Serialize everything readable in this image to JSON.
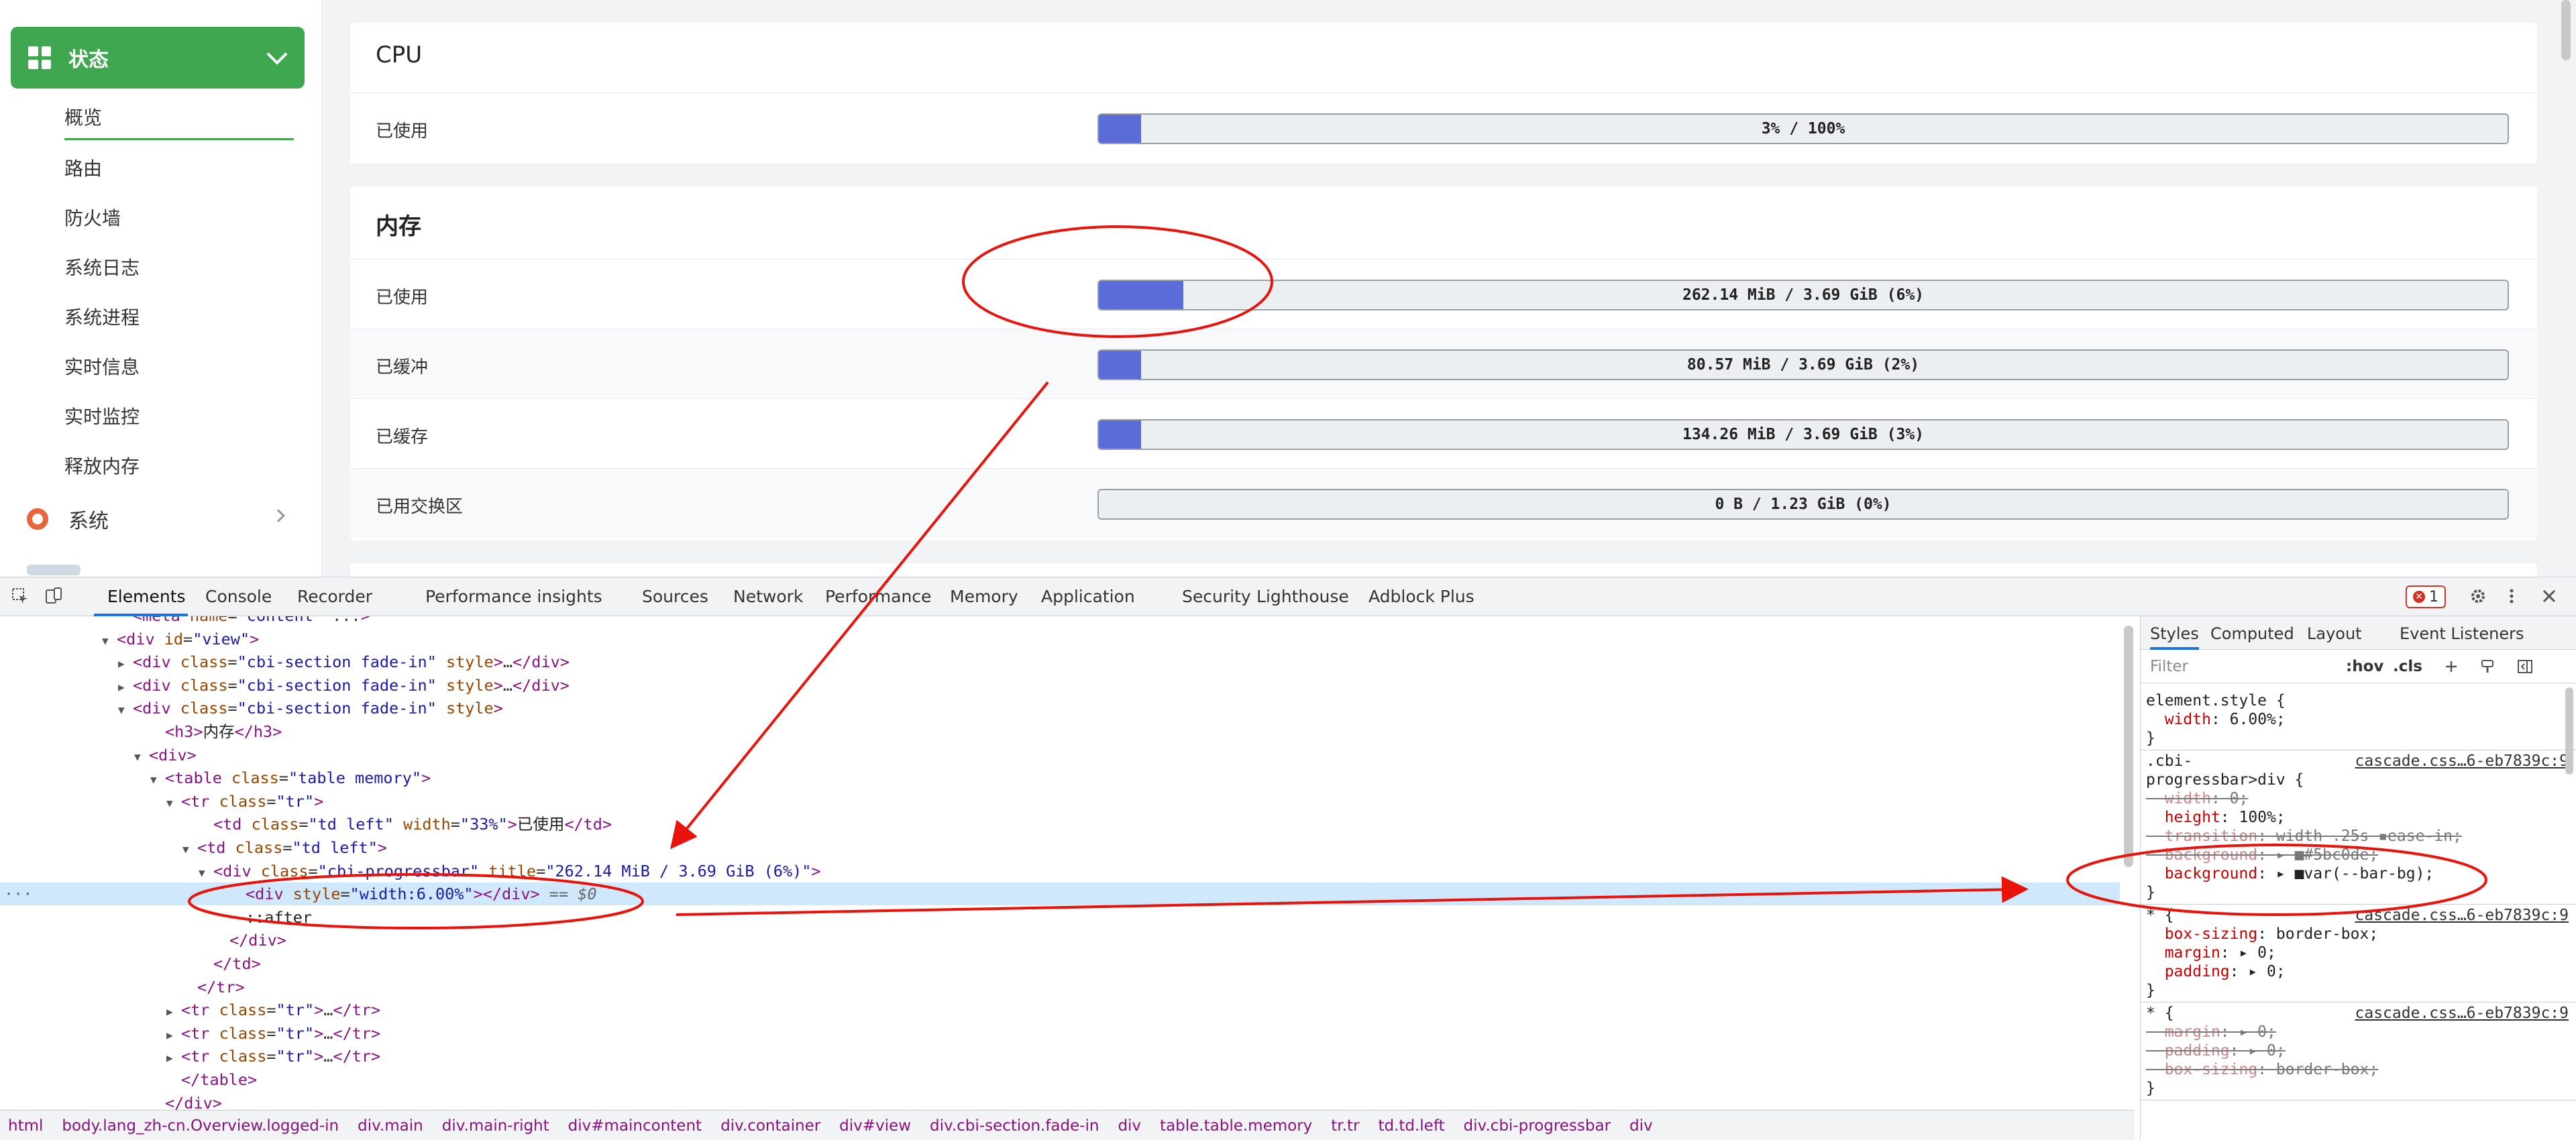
{
  "sidebar": {
    "status_label": "状态",
    "items": [
      "概览",
      "路由",
      "防火墙",
      "系统日志",
      "系统进程",
      "实时信息",
      "实时监控",
      "释放内存"
    ],
    "system_label": "系统"
  },
  "cpu": {
    "title": "CPU",
    "rows": [
      {
        "label": "已使用",
        "text": "3% / 100%",
        "percent": 3
      }
    ]
  },
  "memory": {
    "title": "内存",
    "rows": [
      {
        "label": "已使用",
        "text": "262.14 MiB / 3.69 GiB (6%)",
        "percent": 6
      },
      {
        "label": "已缓冲",
        "text": "80.57 MiB / 3.69 GiB (2%)",
        "percent": 2
      },
      {
        "label": "已缓存",
        "text": "134.26 MiB / 3.69 GiB (3%)",
        "percent": 3
      },
      {
        "label": "已用交换区",
        "text": "0 B / 1.23 GiB (0%)",
        "percent": 0
      }
    ]
  },
  "colors": {
    "accent": "#3fa74f",
    "bar": "#5b6bd8",
    "annotation": "#e8140c"
  },
  "devtools": {
    "tabs": [
      "Elements",
      "Console",
      "Recorder",
      "Performance insights",
      "Sources",
      "Network",
      "Performance",
      "Memory",
      "Application",
      "Security",
      "Lighthouse",
      "Adblock Plus"
    ],
    "error_count": "1",
    "dom_lines": [
      {
        "indent": 7,
        "tri": "",
        "html": "<span class='tg'>&lt;meta</span> <span class='at'>name</span>=<span class='av'>\"content\"</span> ...<span class='tg'>&gt;</span>"
      },
      {
        "indent": 6,
        "tri": "▼",
        "html": "<span class='tg'>&lt;div</span> <span class='at'>id</span>=<span class='av'>\"view\"</span><span class='tg'>&gt;</span>"
      },
      {
        "indent": 7,
        "tri": "▶",
        "html": "<span class='tg'>&lt;div</span> <span class='at'>class</span>=<span class='av'>\"cbi-section fade-in\"</span> <span class='at'>style</span><span class='tg'>&gt;</span>…<span class='tg'>&lt;/div&gt;</span>"
      },
      {
        "indent": 7,
        "tri": "▶",
        "html": "<span class='tg'>&lt;div</span> <span class='at'>class</span>=<span class='av'>\"cbi-section fade-in\"</span> <span class='at'>style</span><span class='tg'>&gt;</span>…<span class='tg'>&lt;/div&gt;</span>"
      },
      {
        "indent": 7,
        "tri": "▼",
        "html": "<span class='tg'>&lt;div</span> <span class='at'>class</span>=<span class='av'>\"cbi-section fade-in\"</span> <span class='at'>style</span><span class='tg'>&gt;</span>"
      },
      {
        "indent": 9,
        "tri": "",
        "html": "<span class='tg'>&lt;h3&gt;</span><span class='tx'>内存</span><span class='tg'>&lt;/h3&gt;</span>"
      },
      {
        "indent": 8,
        "tri": "▼",
        "html": "<span class='tg'>&lt;div&gt;</span>"
      },
      {
        "indent": 9,
        "tri": "▼",
        "html": "<span class='tg'>&lt;table</span> <span class='at'>class</span>=<span class='av'>\"table memory\"</span><span class='tg'>&gt;</span>"
      },
      {
        "indent": 10,
        "tri": "▼",
        "html": "<span class='tg'>&lt;tr</span> <span class='at'>class</span>=<span class='av'>\"tr\"</span><span class='tg'>&gt;</span>"
      },
      {
        "indent": 12,
        "tri": "",
        "html": "<span class='tg'>&lt;td</span> <span class='at'>class</span>=<span class='av'>\"td left\"</span> <span class='at'>width</span>=<span class='av'>\"33%\"</span><span class='tg'>&gt;</span><span class='tx'>已使用</span><span class='tg'>&lt;/td&gt;</span>"
      },
      {
        "indent": 11,
        "tri": "▼",
        "html": "<span class='tg'>&lt;td</span> <span class='at'>class</span>=<span class='av'>\"td left\"</span><span class='tg'>&gt;</span>"
      },
      {
        "indent": 12,
        "tri": "▼",
        "html": "<span class='tg'>&lt;div</span> <span class='at'>class</span>=<span class='av'>\"cbi-progressbar\"</span> <span class='at'>title</span>=<span class='av'>\"262.14 MiB / 3.69 GiB (6%)\"</span><span class='tg'>&gt;</span>"
      },
      {
        "indent": 14,
        "tri": "",
        "sel": true,
        "html": "<span class='tg'>&lt;div</span> <span class='at'>style</span>=<span class='av'>\"width:6.00%\"</span><span class='tg'>&gt;&lt;/div&gt;</span> <span class='cm'>== $0</span>"
      },
      {
        "indent": 14,
        "tri": "",
        "html": "<span class='tx'>::after</span>"
      },
      {
        "indent": 13,
        "tri": "",
        "html": "<span class='tg'>&lt;/div&gt;</span>"
      },
      {
        "indent": 12,
        "tri": "",
        "html": "<span class='tg'>&lt;/td&gt;</span>"
      },
      {
        "indent": 11,
        "tri": "",
        "html": "<span class='tg'>&lt;/tr&gt;</span>"
      },
      {
        "indent": 10,
        "tri": "▶",
        "html": "<span class='tg'>&lt;tr</span> <span class='at'>class</span>=<span class='av'>\"tr\"</span><span class='tg'>&gt;</span>…<span class='tg'>&lt;/tr&gt;</span>"
      },
      {
        "indent": 10,
        "tri": "▶",
        "html": "<span class='tg'>&lt;tr</span> <span class='at'>class</span>=<span class='av'>\"tr\"</span><span class='tg'>&gt;</span>…<span class='tg'>&lt;/tr&gt;</span>"
      },
      {
        "indent": 10,
        "tri": "▶",
        "html": "<span class='tg'>&lt;tr</span> <span class='at'>class</span>=<span class='av'>\"tr\"</span><span class='tg'>&gt;</span>…<span class='tg'>&lt;/tr&gt;</span>"
      },
      {
        "indent": 10,
        "tri": "",
        "html": "<span class='tg'>&lt;/table&gt;</span>"
      },
      {
        "indent": 9,
        "tri": "",
        "html": "<span class='tg'>&lt;/div&gt;</span>"
      }
    ],
    "breadcrumbs": [
      "html",
      "body.lang_zh-cn.Overview.logged-in",
      "div.main",
      "div.main-right",
      "div#maincontent",
      "div.container",
      "div#view",
      "div.cbi-section.fade-in",
      "div",
      "table.table.memory",
      "tr.tr",
      "td.td.left",
      "div.cbi-progressbar",
      "div"
    ],
    "styles_tabs": [
      "Styles",
      "Computed",
      "Layout",
      "Event Listeners"
    ],
    "filter_placeholder": "Filter",
    "hov_label": ":hov",
    "cls_label": ".cls",
    "style_source": "cascade.css…6-eb7839c:9",
    "style_lines": [
      {
        "t": "element.style {"
      },
      {
        "t": "  ",
        "p": "width",
        "v": ": 6.00%;"
      },
      {
        "t": "}"
      },
      {
        "t": ".cbi-",
        "src": true
      },
      {
        "t": "progressbar>div {"
      },
      {
        "t": "  ",
        "p": "width",
        "v": ": 0;",
        "strike": true
      },
      {
        "t": "  ",
        "p": "height",
        "v": ": 100%;"
      },
      {
        "t": "  ",
        "p": "transition",
        "v": ": width .25s ▪ease-in;",
        "strike": true
      },
      {
        "t": "  ",
        "p": "background",
        "v": ": ▸ ■#5bc0de;",
        "strike": true
      },
      {
        "t": "  ",
        "p": "background",
        "v": ": ▸ ■var(--bar-bg);"
      },
      {
        "t": "}"
      },
      {
        "t": "* {",
        "src": true
      },
      {
        "t": "  ",
        "p": "box-sizing",
        "v": ": border-box;"
      },
      {
        "t": "  ",
        "p": "margin",
        "v": ": ▸ 0;"
      },
      {
        "t": "  ",
        "p": "padding",
        "v": ": ▸ 0;"
      },
      {
        "t": "}"
      },
      {
        "t": "* {",
        "src": true
      },
      {
        "t": "  ",
        "p": "margin",
        "v": ": ▸ 0;",
        "strike": true
      },
      {
        "t": "  ",
        "p": "padding",
        "v": ": ▸ 0;",
        "strike": true
      },
      {
        "t": "  ",
        "p": "box-sizing",
        "v": ": border-box;",
        "strike": true
      },
      {
        "t": "}"
      }
    ]
  }
}
